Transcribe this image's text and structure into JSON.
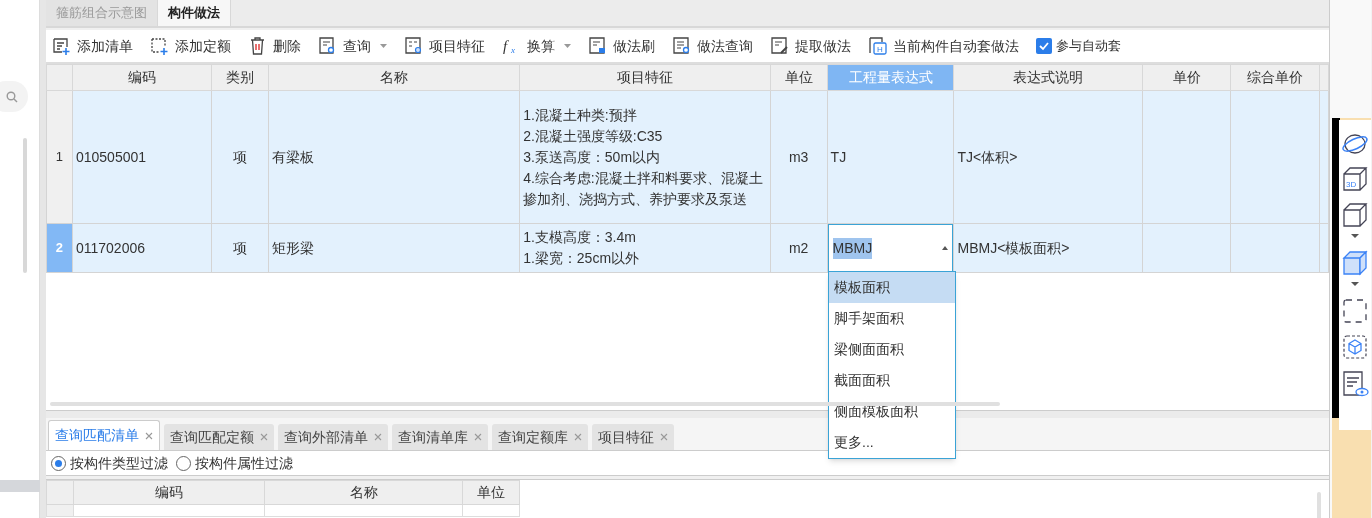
{
  "top_tabs": [
    {
      "label": "箍筋组合示意图",
      "selected": false
    },
    {
      "label": "构件做法",
      "selected": true
    }
  ],
  "toolbar": [
    {
      "kind": "button",
      "label": "添加清单"
    },
    {
      "kind": "button",
      "label": "添加定额"
    },
    {
      "kind": "button",
      "label": "删除"
    },
    {
      "kind": "dropdown",
      "label": "查询"
    },
    {
      "kind": "button",
      "label": "项目特征"
    },
    {
      "kind": "dropdown",
      "label": "换算",
      "icon_text": [
        "f",
        "x"
      ]
    },
    {
      "kind": "button",
      "label": "做法刷"
    },
    {
      "kind": "button",
      "label": "做法查询"
    },
    {
      "kind": "button",
      "label": "提取做法"
    },
    {
      "kind": "button",
      "label": "当前构件自动套做法",
      "icon_text": [
        "H"
      ]
    },
    {
      "kind": "checkbox",
      "label": "参与自动套",
      "checked": true
    }
  ],
  "table": {
    "columns": [
      {
        "label": "编码",
        "selected": false
      },
      {
        "label": "类别",
        "selected": false
      },
      {
        "label": "名称",
        "selected": false
      },
      {
        "label": "项目特征",
        "selected": false
      },
      {
        "label": "单位",
        "selected": false
      },
      {
        "label": "工程量表达式",
        "selected": true
      },
      {
        "label": "表达式说明",
        "selected": false
      },
      {
        "label": "单价",
        "selected": false
      },
      {
        "label": "综合单价",
        "selected": false
      }
    ],
    "rows": [
      {
        "number": "1",
        "selected": false,
        "code": "010505001",
        "category": "项",
        "name": "有梁板",
        "features": [
          "1.混凝土种类:预拌",
          "2.混凝土强度等级:C35",
          "3.泵送高度：50m以内",
          "4.综合考虑:混凝土拌和料要求、混凝土掺加剂、浇捣方式、养护要求及泵送"
        ],
        "unit": "m3",
        "expression": "TJ",
        "description": "TJ<体积>"
      },
      {
        "number": "2",
        "selected": true,
        "code": "011702006",
        "category": "项",
        "name": "矩形梁",
        "features": [
          "1.支模高度：3.4m",
          "1.梁宽：25cm以外"
        ],
        "unit": "m2",
        "expression": "MBMJ",
        "description": "MBMJ<模板面积>"
      }
    ]
  },
  "expression_dropdown": [
    {
      "label": "模板面积",
      "selected": true
    },
    {
      "label": "脚手架面积",
      "selected": false
    },
    {
      "label": "梁侧面面积",
      "selected": false
    },
    {
      "label": "截面面积",
      "selected": false
    },
    {
      "label": "侧面模板面积",
      "selected": false
    },
    {
      "label": "更多...",
      "selected": false
    }
  ],
  "bottom_tabs": [
    {
      "label": "查询匹配清单",
      "selected": true
    },
    {
      "label": "查询匹配定额",
      "selected": false
    },
    {
      "label": "查询外部清单",
      "selected": false
    },
    {
      "label": "查询清单库",
      "selected": false
    },
    {
      "label": "查询定额库",
      "selected": false
    },
    {
      "label": "项目特征",
      "selected": false
    }
  ],
  "filters": [
    {
      "label": "按构件类型过滤",
      "selected": true
    },
    {
      "label": "按构件属性过滤",
      "selected": false
    }
  ],
  "bottom_table": {
    "columns": [
      "编码",
      "名称",
      "单位"
    ]
  },
  "view_toolbar": {
    "box_icon_text": "3D"
  }
}
